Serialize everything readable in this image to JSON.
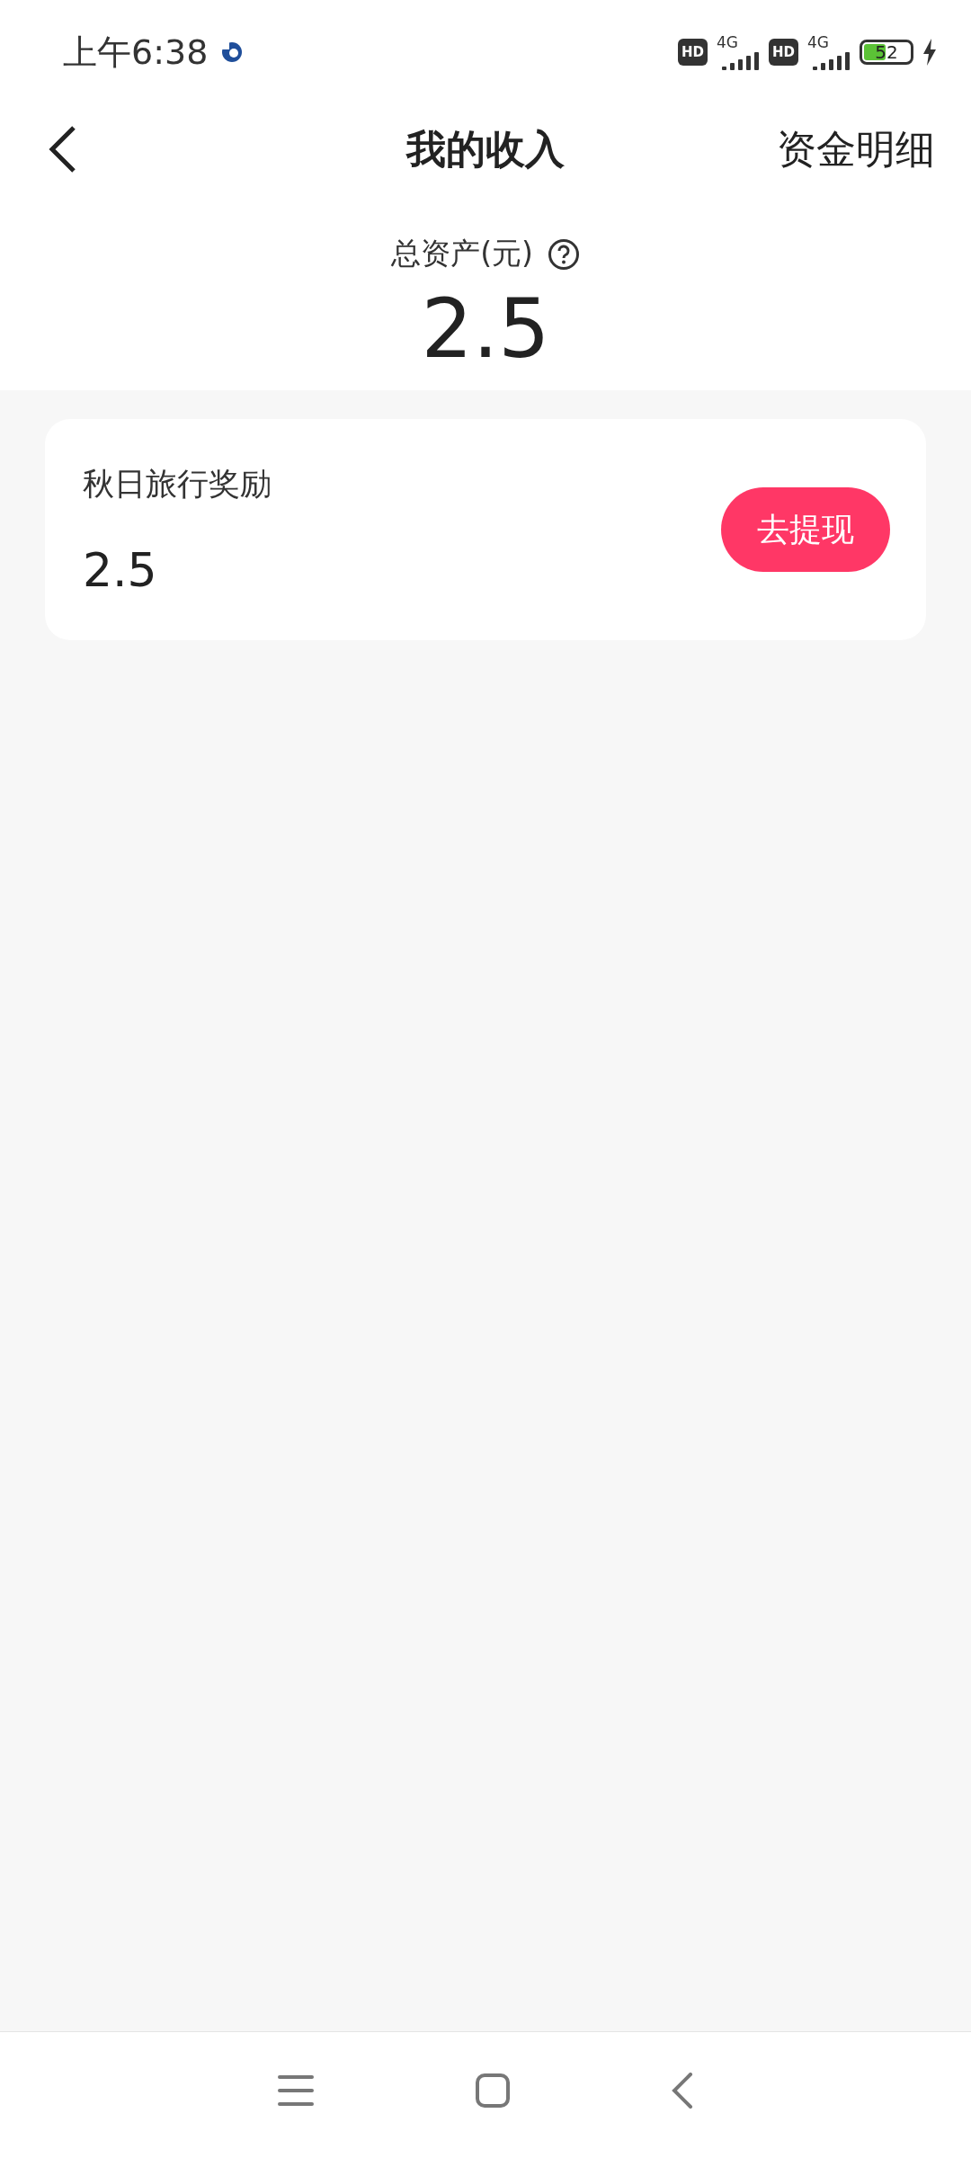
{
  "status_bar": {
    "time": "上午6:38",
    "sim_labels": [
      "HD",
      "HD"
    ],
    "network": [
      "4G",
      "4G"
    ],
    "battery": "52"
  },
  "header": {
    "title": "我的收入",
    "action": "资金明细"
  },
  "summary": {
    "label": "总资产(元)",
    "amount": "2.5"
  },
  "cards": [
    {
      "title": "秋日旅行奖励",
      "amount": "2.5",
      "button": "去提现"
    }
  ]
}
